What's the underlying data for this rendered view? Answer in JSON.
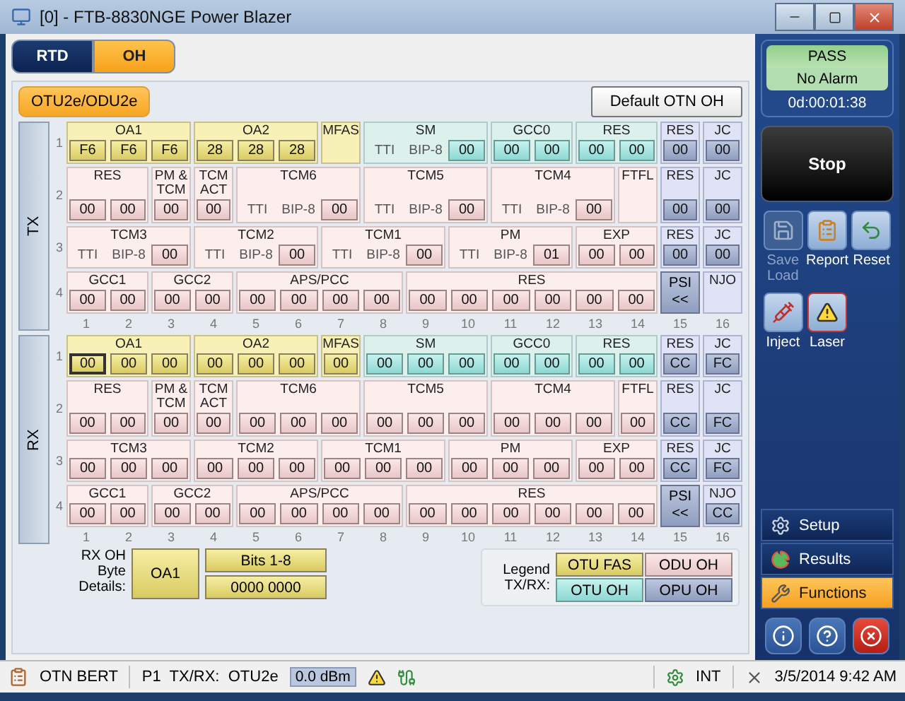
{
  "window": {
    "title": "[0] - FTB-8830NGE Power Blazer"
  },
  "tabs": [
    {
      "label": "RTD",
      "selected": false
    },
    {
      "label": "OH",
      "selected": true
    }
  ],
  "subtabs": [
    {
      "label": "OTU2e/ODU2e",
      "selected": true
    }
  ],
  "default_button": "Default OTN OH",
  "sections": [
    {
      "label": "TX",
      "rows": [
        {
          "number": "1",
          "groups": [
            {
              "label": "OA1",
              "kind": "fas",
              "values": [
                {
                  "text": "F6",
                  "selected": false
                },
                {
                  "text": "F6",
                  "selected": false
                },
                {
                  "text": "F6",
                  "selected": false
                }
              ]
            },
            {
              "label": "OA2",
              "kind": "fas",
              "values": [
                {
                  "text": "28",
                  "selected": false
                },
                {
                  "text": "28",
                  "selected": false
                },
                {
                  "text": "28",
                  "selected": false
                }
              ]
            },
            {
              "label": "MFAS",
              "kind": "fas"
            },
            {
              "label": "SM",
              "kind": "otu",
              "texts": [
                "TTI",
                "BIP-8"
              ],
              "values": [
                {
                  "text": "00",
                  "selected": false
                }
              ]
            },
            {
              "label": "GCC0",
              "kind": "otu",
              "values": [
                {
                  "text": "00",
                  "selected": false
                },
                {
                  "text": "00",
                  "selected": false
                }
              ]
            },
            {
              "label": "RES",
              "kind": "otu",
              "values": [
                {
                  "text": "00",
                  "selected": false
                },
                {
                  "text": "00",
                  "selected": false
                }
              ]
            },
            {
              "label": "RES",
              "kind": "opu",
              "values": [
                {
                  "text": "00",
                  "selected": false
                }
              ]
            },
            {
              "label": "JC",
              "kind": "opu",
              "values": [
                {
                  "text": "00",
                  "selected": false
                }
              ]
            }
          ]
        },
        {
          "number": "2",
          "groups": [
            {
              "label": "RES",
              "kind": "odu",
              "values": [
                {
                  "text": "00",
                  "selected": false
                },
                {
                  "text": "00",
                  "selected": false
                }
              ]
            },
            {
              "label": "PM & TCM",
              "kind": "odu",
              "values": [
                {
                  "text": "00",
                  "selected": false
                }
              ]
            },
            {
              "label": "TCM ACT",
              "kind": "odu",
              "values": [
                {
                  "text": "00",
                  "selected": false
                }
              ]
            },
            {
              "label": "TCM6",
              "kind": "odu",
              "texts": [
                "TTI",
                "BIP-8"
              ],
              "values": [
                {
                  "text": "00",
                  "selected": false
                }
              ]
            },
            {
              "label": "TCM5",
              "kind": "odu",
              "texts": [
                "TTI",
                "BIP-8"
              ],
              "values": [
                {
                  "text": "00",
                  "selected": false
                }
              ]
            },
            {
              "label": "TCM4",
              "kind": "odu",
              "texts": [
                "TTI",
                "BIP-8"
              ],
              "values": [
                {
                  "text": "00",
                  "selected": false
                }
              ]
            },
            {
              "label": "FTFL",
              "kind": "odu"
            },
            {
              "label": "RES",
              "kind": "opu",
              "values": [
                {
                  "text": "00",
                  "selected": false
                }
              ]
            },
            {
              "label": "JC",
              "kind": "opu",
              "values": [
                {
                  "text": "00",
                  "selected": false
                }
              ]
            }
          ]
        },
        {
          "number": "3",
          "groups": [
            {
              "label": "TCM3",
              "kind": "odu",
              "texts": [
                "TTI",
                "BIP-8"
              ],
              "values": [
                {
                  "text": "00",
                  "selected": false
                }
              ]
            },
            {
              "label": "TCM2",
              "kind": "odu",
              "texts": [
                "TTI",
                "BIP-8"
              ],
              "values": [
                {
                  "text": "00",
                  "selected": false
                }
              ]
            },
            {
              "label": "TCM1",
              "kind": "odu",
              "texts": [
                "TTI",
                "BIP-8"
              ],
              "values": [
                {
                  "text": "00",
                  "selected": false
                }
              ]
            },
            {
              "label": "PM",
              "kind": "odu",
              "texts": [
                "TTI",
                "BIP-8"
              ],
              "values": [
                {
                  "text": "01",
                  "selected": false
                }
              ]
            },
            {
              "label": "EXP",
              "kind": "odu",
              "values": [
                {
                  "text": "00",
                  "selected": false
                },
                {
                  "text": "00",
                  "selected": false
                }
              ]
            },
            {
              "label": "RES",
              "kind": "opu",
              "values": [
                {
                  "text": "00",
                  "selected": false
                }
              ]
            },
            {
              "label": "JC",
              "kind": "opu",
              "values": [
                {
                  "text": "00",
                  "selected": false
                }
              ]
            }
          ]
        },
        {
          "number": "4",
          "groups": [
            {
              "label": "GCC1",
              "kind": "odu",
              "values": [
                {
                  "text": "00",
                  "selected": false
                },
                {
                  "text": "00",
                  "selected": false
                }
              ]
            },
            {
              "label": "GCC2",
              "kind": "odu",
              "values": [
                {
                  "text": "00",
                  "selected": false
                },
                {
                  "text": "00",
                  "selected": false
                }
              ]
            },
            {
              "label": "APS/PCC",
              "kind": "odu",
              "values": [
                {
                  "text": "00",
                  "selected": false
                },
                {
                  "text": "00",
                  "selected": false
                },
                {
                  "text": "00",
                  "selected": false
                },
                {
                  "text": "00",
                  "selected": false
                }
              ]
            },
            {
              "label": "RES",
              "kind": "odu",
              "values": [
                {
                  "text": "00",
                  "selected": false
                },
                {
                  "text": "00",
                  "selected": false
                },
                {
                  "text": "00",
                  "selected": false
                },
                {
                  "text": "00",
                  "selected": false
                },
                {
                  "text": "00",
                  "selected": false
                },
                {
                  "text": "00",
                  "selected": false
                }
              ]
            },
            {
              "label": "PSI",
              "kind": "psi",
              "values": [
                {
                  "text": "<<",
                  "selected": false
                }
              ]
            },
            {
              "label": "NJO",
              "kind": "opu"
            }
          ]
        }
      ],
      "column_numbers": [
        "1",
        "2",
        "3",
        "4",
        "5",
        "6",
        "7",
        "8",
        "9",
        "10",
        "11",
        "12",
        "13",
        "14",
        "15",
        "16"
      ]
    },
    {
      "label": "RX",
      "rows": [
        {
          "number": "1",
          "groups": [
            {
              "label": "OA1",
              "kind": "fas",
              "values": [
                {
                  "text": "00",
                  "selected": true
                },
                {
                  "text": "00",
                  "selected": false
                },
                {
                  "text": "00",
                  "selected": false
                }
              ]
            },
            {
              "label": "OA2",
              "kind": "fas",
              "values": [
                {
                  "text": "00",
                  "selected": false
                },
                {
                  "text": "00",
                  "selected": false
                },
                {
                  "text": "00",
                  "selected": false
                }
              ]
            },
            {
              "label": "MFAS",
              "kind": "fas",
              "values": [
                {
                  "text": "00",
                  "selected": false
                }
              ]
            },
            {
              "label": "SM",
              "kind": "otu",
              "values": [
                {
                  "text": "00",
                  "selected": false
                },
                {
                  "text": "00",
                  "selected": false
                },
                {
                  "text": "00",
                  "selected": false
                }
              ]
            },
            {
              "label": "GCC0",
              "kind": "otu",
              "values": [
                {
                  "text": "00",
                  "selected": false
                },
                {
                  "text": "00",
                  "selected": false
                }
              ]
            },
            {
              "label": "RES",
              "kind": "otu",
              "values": [
                {
                  "text": "00",
                  "selected": false
                },
                {
                  "text": "00",
                  "selected": false
                }
              ]
            },
            {
              "label": "RES",
              "kind": "opu",
              "values": [
                {
                  "text": "CC",
                  "selected": false
                }
              ]
            },
            {
              "label": "JC",
              "kind": "opu",
              "values": [
                {
                  "text": "FC",
                  "selected": false
                }
              ]
            }
          ]
        },
        {
          "number": "2",
          "groups": [
            {
              "label": "RES",
              "kind": "odu",
              "values": [
                {
                  "text": "00",
                  "selected": false
                },
                {
                  "text": "00",
                  "selected": false
                }
              ]
            },
            {
              "label": "PM & TCM",
              "kind": "odu",
              "values": [
                {
                  "text": "00",
                  "selected": false
                }
              ]
            },
            {
              "label": "TCM ACT",
              "kind": "odu",
              "values": [
                {
                  "text": "00",
                  "selected": false
                }
              ]
            },
            {
              "label": "TCM6",
              "kind": "odu",
              "values": [
                {
                  "text": "00",
                  "selected": false
                },
                {
                  "text": "00",
                  "selected": false
                },
                {
                  "text": "00",
                  "selected": false
                }
              ]
            },
            {
              "label": "TCM5",
              "kind": "odu",
              "values": [
                {
                  "text": "00",
                  "selected": false
                },
                {
                  "text": "00",
                  "selected": false
                },
                {
                  "text": "00",
                  "selected": false
                }
              ]
            },
            {
              "label": "TCM4",
              "kind": "odu",
              "values": [
                {
                  "text": "00",
                  "selected": false
                },
                {
                  "text": "00",
                  "selected": false
                },
                {
                  "text": "00",
                  "selected": false
                }
              ]
            },
            {
              "label": "FTFL",
              "kind": "odu",
              "values": [
                {
                  "text": "00",
                  "selected": false
                }
              ]
            },
            {
              "label": "RES",
              "kind": "opu",
              "values": [
                {
                  "text": "CC",
                  "selected": false
                }
              ]
            },
            {
              "label": "JC",
              "kind": "opu",
              "values": [
                {
                  "text": "FC",
                  "selected": false
                }
              ]
            }
          ]
        },
        {
          "number": "3",
          "groups": [
            {
              "label": "TCM3",
              "kind": "odu",
              "values": [
                {
                  "text": "00",
                  "selected": false
                },
                {
                  "text": "00",
                  "selected": false
                },
                {
                  "text": "00",
                  "selected": false
                }
              ]
            },
            {
              "label": "TCM2",
              "kind": "odu",
              "values": [
                {
                  "text": "00",
                  "selected": false
                },
                {
                  "text": "00",
                  "selected": false
                },
                {
                  "text": "00",
                  "selected": false
                }
              ]
            },
            {
              "label": "TCM1",
              "kind": "odu",
              "values": [
                {
                  "text": "00",
                  "selected": false
                },
                {
                  "text": "00",
                  "selected": false
                },
                {
                  "text": "00",
                  "selected": false
                }
              ]
            },
            {
              "label": "PM",
              "kind": "odu",
              "values": [
                {
                  "text": "00",
                  "selected": false
                },
                {
                  "text": "00",
                  "selected": false
                },
                {
                  "text": "00",
                  "selected": false
                }
              ]
            },
            {
              "label": "EXP",
              "kind": "odu",
              "values": [
                {
                  "text": "00",
                  "selected": false
                },
                {
                  "text": "00",
                  "selected": false
                }
              ]
            },
            {
              "label": "RES",
              "kind": "opu",
              "values": [
                {
                  "text": "CC",
                  "selected": false
                }
              ]
            },
            {
              "label": "JC",
              "kind": "opu",
              "values": [
                {
                  "text": "FC",
                  "selected": false
                }
              ]
            }
          ]
        },
        {
          "number": "4",
          "groups": [
            {
              "label": "GCC1",
              "kind": "odu",
              "values": [
                {
                  "text": "00",
                  "selected": false
                },
                {
                  "text": "00",
                  "selected": false
                }
              ]
            },
            {
              "label": "GCC2",
              "kind": "odu",
              "values": [
                {
                  "text": "00",
                  "selected": false
                },
                {
                  "text": "00",
                  "selected": false
                }
              ]
            },
            {
              "label": "APS/PCC",
              "kind": "odu",
              "values": [
                {
                  "text": "00",
                  "selected": false
                },
                {
                  "text": "00",
                  "selected": false
                },
                {
                  "text": "00",
                  "selected": false
                },
                {
                  "text": "00",
                  "selected": false
                }
              ]
            },
            {
              "label": "RES",
              "kind": "odu",
              "values": [
                {
                  "text": "00",
                  "selected": false
                },
                {
                  "text": "00",
                  "selected": false
                },
                {
                  "text": "00",
                  "selected": false
                },
                {
                  "text": "00",
                  "selected": false
                },
                {
                  "text": "00",
                  "selected": false
                },
                {
                  "text": "00",
                  "selected": false
                }
              ]
            },
            {
              "label": "PSI",
              "kind": "psi",
              "values": [
                {
                  "text": "<<",
                  "selected": false
                }
              ]
            },
            {
              "label": "NJO",
              "kind": "opu",
              "values": [
                {
                  "text": "CC",
                  "selected": false
                }
              ]
            }
          ]
        }
      ],
      "column_numbers": [
        "1",
        "2",
        "3",
        "4",
        "5",
        "6",
        "7",
        "8",
        "9",
        "10",
        "11",
        "12",
        "13",
        "14",
        "15",
        "16"
      ]
    }
  ],
  "byte_details": {
    "label": "RX OH Byte Details:",
    "field": "OA1",
    "bits_label": "Bits 1-8",
    "bits_value": "0000 0000"
  },
  "legend": {
    "title": "Legend TX/RX:",
    "items": [
      {
        "label": "OTU FAS",
        "kind": "fas"
      },
      {
        "label": "ODU OH",
        "kind": "odu"
      },
      {
        "label": "OTU OH",
        "kind": "otu"
      },
      {
        "label": "OPU OH",
        "kind": "opu"
      }
    ]
  },
  "status": {
    "verdict": "PASS",
    "alarm": "No Alarm",
    "elapsed": "0d:00:01:38"
  },
  "stop_button": "Stop",
  "actions": [
    {
      "label": "Save Load",
      "kind": "save",
      "disabled": true
    },
    {
      "label": "Report",
      "kind": "report",
      "disabled": false
    },
    {
      "label": "Reset",
      "kind": "reset",
      "disabled": false
    },
    {
      "label": "Inject",
      "kind": "inject",
      "disabled": false
    },
    {
      "label": "Laser",
      "kind": "laser",
      "disabled": false
    }
  ],
  "nav": [
    {
      "label": "Setup",
      "kind": "setup",
      "selected": false
    },
    {
      "label": "Results",
      "kind": "results",
      "selected": false
    },
    {
      "label": "Functions",
      "kind": "functions",
      "selected": true
    }
  ],
  "status_bar": {
    "test": "OTN BERT",
    "port": "P1  TX/RX:  OTU2e",
    "power": "0.0 dBm",
    "clock": "INT",
    "datetime": "3/5/2014 9:42 AM"
  }
}
